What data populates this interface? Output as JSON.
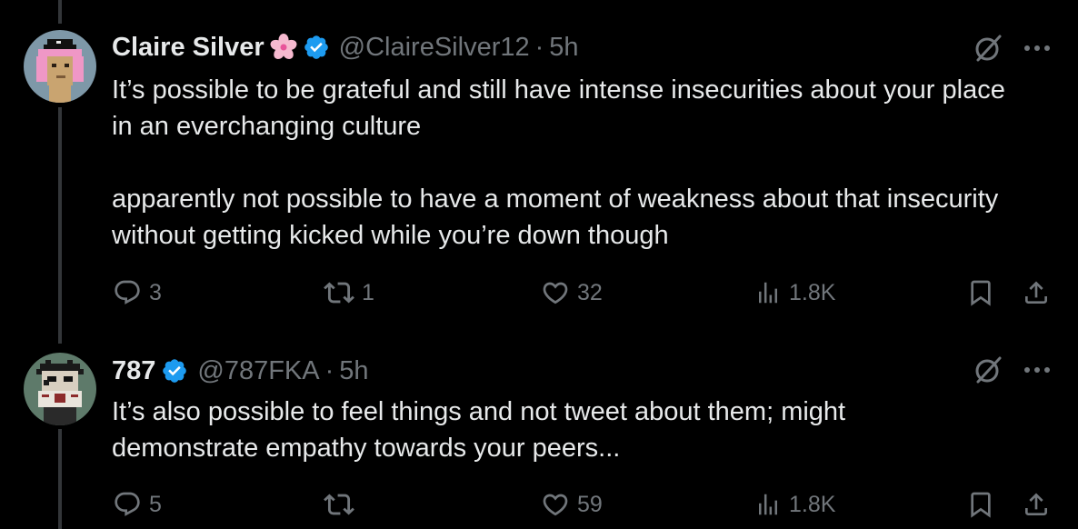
{
  "tweets": [
    {
      "display_name": "Claire Silver",
      "name_emoji": "cherry-blossom-emoji",
      "verified": true,
      "handle": "@ClaireSilver12",
      "separator": "·",
      "time": "5h",
      "paragraphs": [
        "It’s possible to be grateful and still have intense insecurities about your place in an everchanging culture",
        "apparently not possible to have a moment of weakness about that insecurity without getting kicked while you’re down though"
      ],
      "actions": {
        "replies": "3",
        "reposts": "1",
        "likes": "32",
        "views": "1.8K"
      }
    },
    {
      "display_name": "787",
      "verified": true,
      "handle": "@787FKA",
      "separator": "·",
      "time": "5h",
      "paragraphs": [
        "It’s also possible to feel things and not tweet about them; might demonstrate empathy towards your peers..."
      ],
      "actions": {
        "replies": "5",
        "reposts": "",
        "likes": "59",
        "views": "1.8K"
      }
    }
  ],
  "colors": {
    "background": "#000000",
    "text": "#e7e9ea",
    "muted": "#71767b",
    "verified": "#1d9bf0",
    "thread_line": "#333639"
  },
  "icons": [
    "reply-icon",
    "repost-icon",
    "like-icon",
    "views-icon",
    "bookmark-icon",
    "share-icon",
    "grok-icon",
    "more-icon",
    "verified-badge-icon"
  ]
}
